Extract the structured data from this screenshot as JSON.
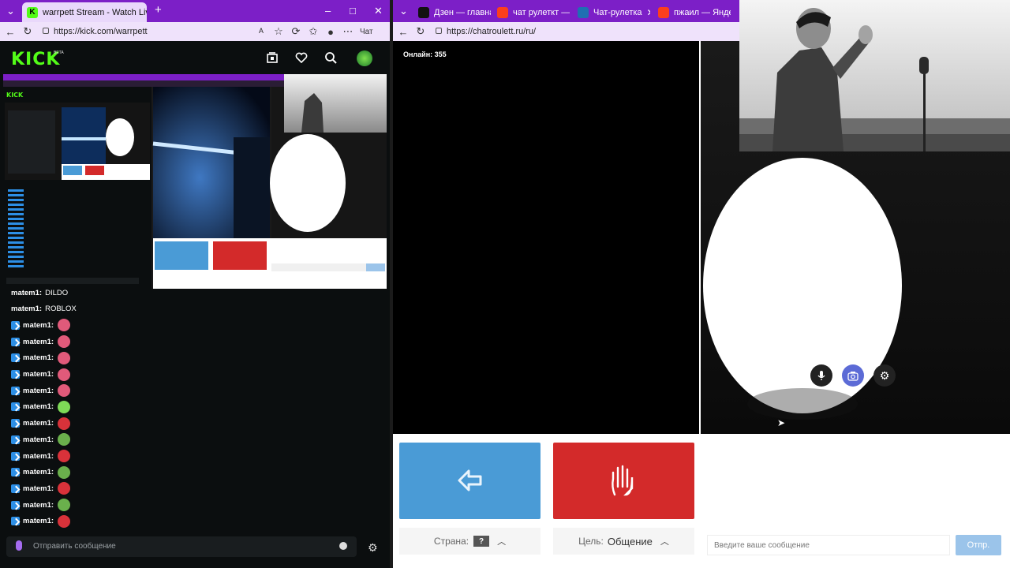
{
  "left_browser": {
    "tabs": [
      {
        "title": "warrpett Stream - Watch Live on K",
        "favicon_color": "#53fc18"
      }
    ],
    "url": "https://kick.com/warrpett",
    "ai_label": "Чат"
  },
  "kick": {
    "logo": "KICK",
    "beta": "BETA",
    "header_icons": [
      "browse-icon",
      "heart-icon",
      "search-icon",
      "avatar"
    ]
  },
  "chat": {
    "messages": [
      {
        "user": "matem1:",
        "text": "DILDO",
        "badge": false,
        "emote": ""
      },
      {
        "user": "matem1:",
        "text": "ROBLOX",
        "badge": false,
        "emote": ""
      },
      {
        "user": "matem1:",
        "text": "",
        "badge": true,
        "emote": "#e05a7a"
      },
      {
        "user": "matem1:",
        "text": "",
        "badge": true,
        "emote": "#e05a7a"
      },
      {
        "user": "matem1:",
        "text": "",
        "badge": true,
        "emote": "#e05a7a"
      },
      {
        "user": "matem1:",
        "text": "",
        "badge": true,
        "emote": "#e05a7a"
      },
      {
        "user": "matem1:",
        "text": "",
        "badge": true,
        "emote": "#e05a7a"
      },
      {
        "user": "matem1:",
        "text": "",
        "badge": true,
        "emote": "#7ed957"
      },
      {
        "user": "matem1:",
        "text": "",
        "badge": true,
        "emote": "#d8323a"
      },
      {
        "user": "matem1:",
        "text": "",
        "badge": true,
        "emote": "#6ab04c"
      },
      {
        "user": "matem1:",
        "text": "",
        "badge": true,
        "emote": "#d8323a"
      },
      {
        "user": "matem1:",
        "text": "",
        "badge": true,
        "emote": "#6ab04c"
      },
      {
        "user": "matem1:",
        "text": "",
        "badge": true,
        "emote": "#d8323a"
      },
      {
        "user": "matem1:",
        "text": "",
        "badge": true,
        "emote": "#6ab04c"
      },
      {
        "user": "matem1:",
        "text": "",
        "badge": true,
        "emote": "#d8323a"
      }
    ],
    "input_placeholder": "Отправить сообщение"
  },
  "right_browser": {
    "tabs": [
      {
        "title": "Дзен — главная",
        "favicon_color": "#111111"
      },
      {
        "title": "чат рулеткт — Ян",
        "favicon_color": "#fc3f1d"
      },
      {
        "title": "Чат-рулетка",
        "favicon_color": "#1f6fb2"
      },
      {
        "title": "пжаил — Яндекс",
        "favicon_color": "#fc3f1d"
      }
    ],
    "url": "https://chatroulett.ru/ru/"
  },
  "roulette": {
    "online_label": "Онлайн: 355",
    "country_label": "Страна:",
    "country_value": "?",
    "goal_label": "Цель:",
    "goal_value": "Общение",
    "message_placeholder": "Введите ваше сообщение",
    "send_label": "Отпр.",
    "next_color": "#4a9bd6",
    "stop_color": "#d32a2a"
  }
}
